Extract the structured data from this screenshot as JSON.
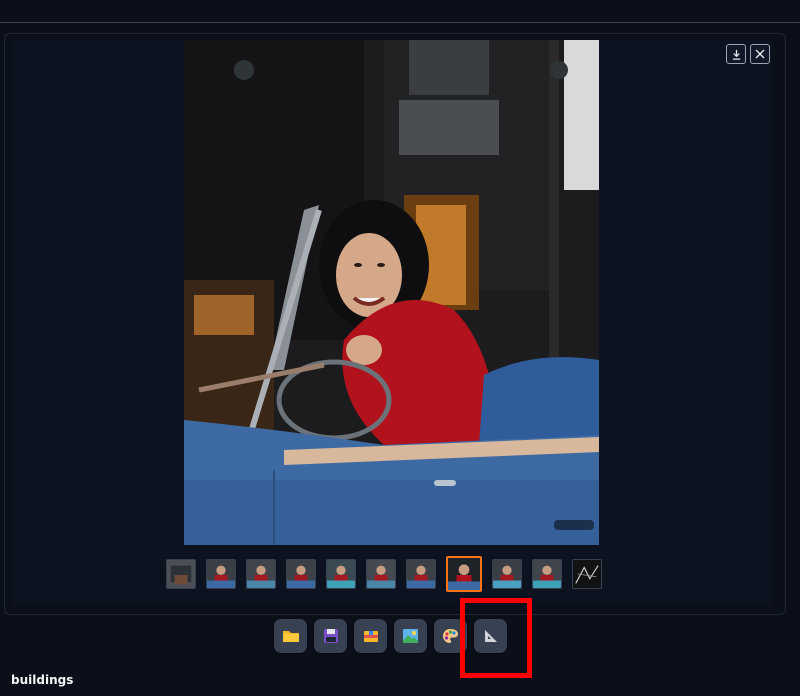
{
  "gallery": {
    "thumbnail_count": 11,
    "selected_thumbnail_index": 7
  },
  "top_controls": {
    "download_icon": "download-icon",
    "close_icon": "close-icon"
  },
  "toolbar": {
    "buttons": [
      {
        "icon": "folder-icon"
      },
      {
        "icon": "save-icon"
      },
      {
        "icon": "zip-archive-icon"
      },
      {
        "icon": "image-icon"
      },
      {
        "icon": "palette-icon"
      },
      {
        "icon": "ruler-triangle-icon"
      }
    ]
  },
  "footer": {
    "label": "buildings"
  },
  "colors": {
    "background": "#0b0f19",
    "panel": "#0d1220",
    "button": "#374151",
    "selected_border": "#f97316",
    "highlight": "#ff0000"
  }
}
